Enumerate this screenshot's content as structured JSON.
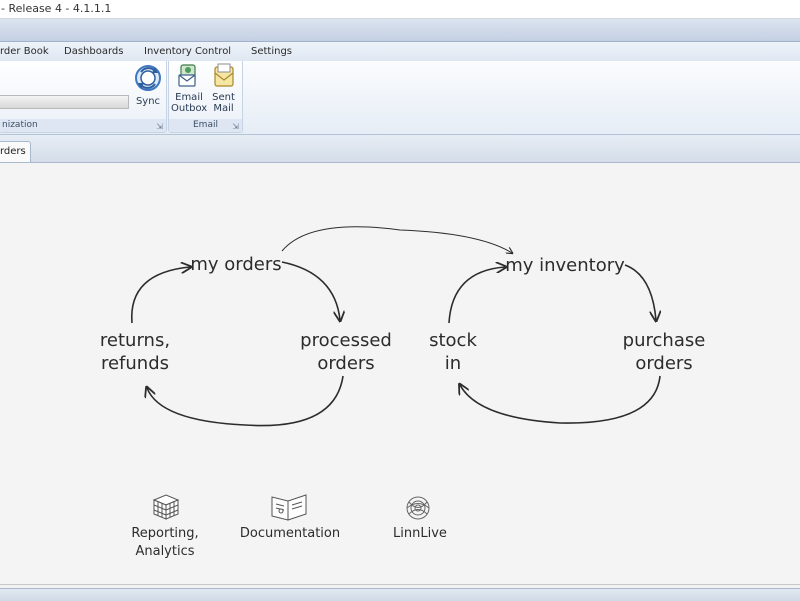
{
  "window": {
    "title": "- Release 4 - 4.1.1.1"
  },
  "menu": {
    "tabs": [
      "rder Book",
      "Dashboards",
      "Inventory Control",
      "Settings"
    ]
  },
  "ribbon": {
    "sync_group_label": "nization",
    "sync_label": "Sync",
    "email_group_label": "Email",
    "email_outbox_label": [
      "Email",
      "Outbox"
    ],
    "sent_mail_label": [
      "Sent",
      "Mail"
    ]
  },
  "doc_tab": {
    "label": "rders"
  },
  "diagram": {
    "my_orders": "my orders",
    "processed_orders": [
      "processed",
      "orders"
    ],
    "returns_refunds": [
      "returns,",
      "refunds"
    ],
    "my_inventory": "my inventory",
    "purchase_orders": [
      "purchase",
      "orders"
    ],
    "stock_in": [
      "stock",
      "in"
    ]
  },
  "shortcuts": {
    "reporting": [
      "Reporting,",
      "Analytics"
    ],
    "documentation": "Documentation",
    "linnlive": "LinnLive"
  },
  "colors": {
    "ink": "#2c2c2c",
    "ribbon_blue": "#2a3b52",
    "sync_blue": "#3f78c0"
  }
}
